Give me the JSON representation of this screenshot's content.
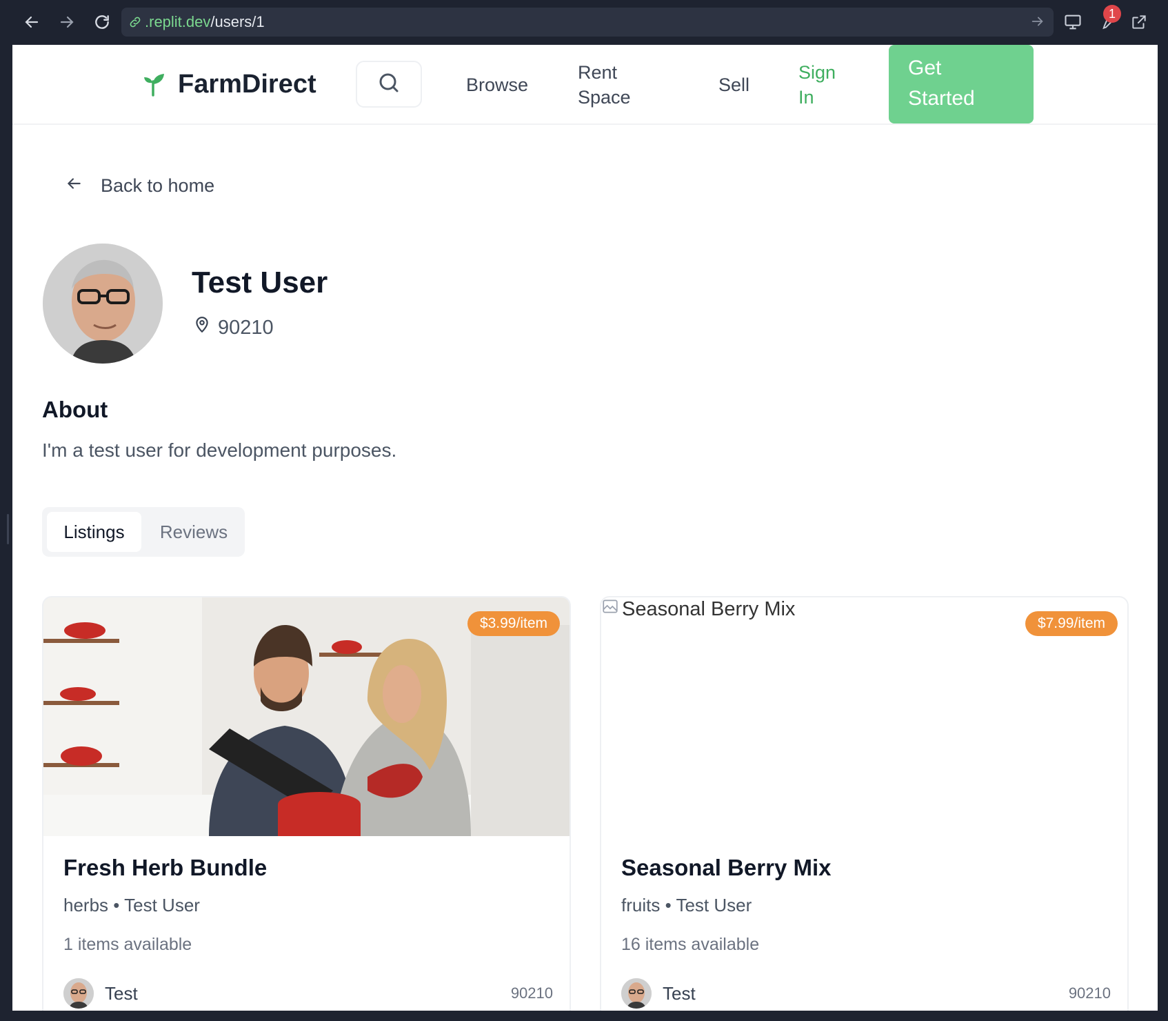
{
  "browser": {
    "url_host": ".replit.dev",
    "url_path": "/users/1",
    "notification_count": "1"
  },
  "header": {
    "brand": "FarmDirect",
    "nav": {
      "browse": "Browse",
      "rent_line1": "Rent",
      "rent_line2": "Space",
      "sell": "Sell",
      "signin_line1": "Sign",
      "signin_line2": "In",
      "cta_line1": "Get",
      "cta_line2": "Started"
    }
  },
  "back_link": "Back to home",
  "profile": {
    "name": "Test User",
    "location": "90210",
    "about_heading": "About",
    "about_text": "I'm a test user for development purposes."
  },
  "tabs": [
    {
      "label": "Listings",
      "active": true
    },
    {
      "label": "Reviews",
      "active": false
    }
  ],
  "listings": [
    {
      "title": "Fresh Herb Bundle",
      "price": "$3.99/item",
      "category": "herbs",
      "seller_name": "Test User",
      "availability": "1 items available",
      "seller_short": "Test",
      "zip": "90210"
    },
    {
      "title": "Seasonal Berry Mix",
      "image_alt": "Seasonal Berry Mix",
      "price": "$7.99/item",
      "category": "fruits",
      "seller_name": "Test User",
      "availability": "16 items available",
      "seller_short": "Test",
      "zip": "90210"
    }
  ],
  "colors": {
    "brand_green": "#6fd18f",
    "link_green": "#3fae5f",
    "price_orange": "#f0923a",
    "chrome_bg": "#1e2330"
  },
  "icons": [
    "arrow-left-icon",
    "arrow-right-icon",
    "reload-icon",
    "link-icon",
    "monitor-icon",
    "wrench-icon",
    "external-link-icon",
    "sprout-icon",
    "search-icon",
    "map-pin-icon"
  ]
}
